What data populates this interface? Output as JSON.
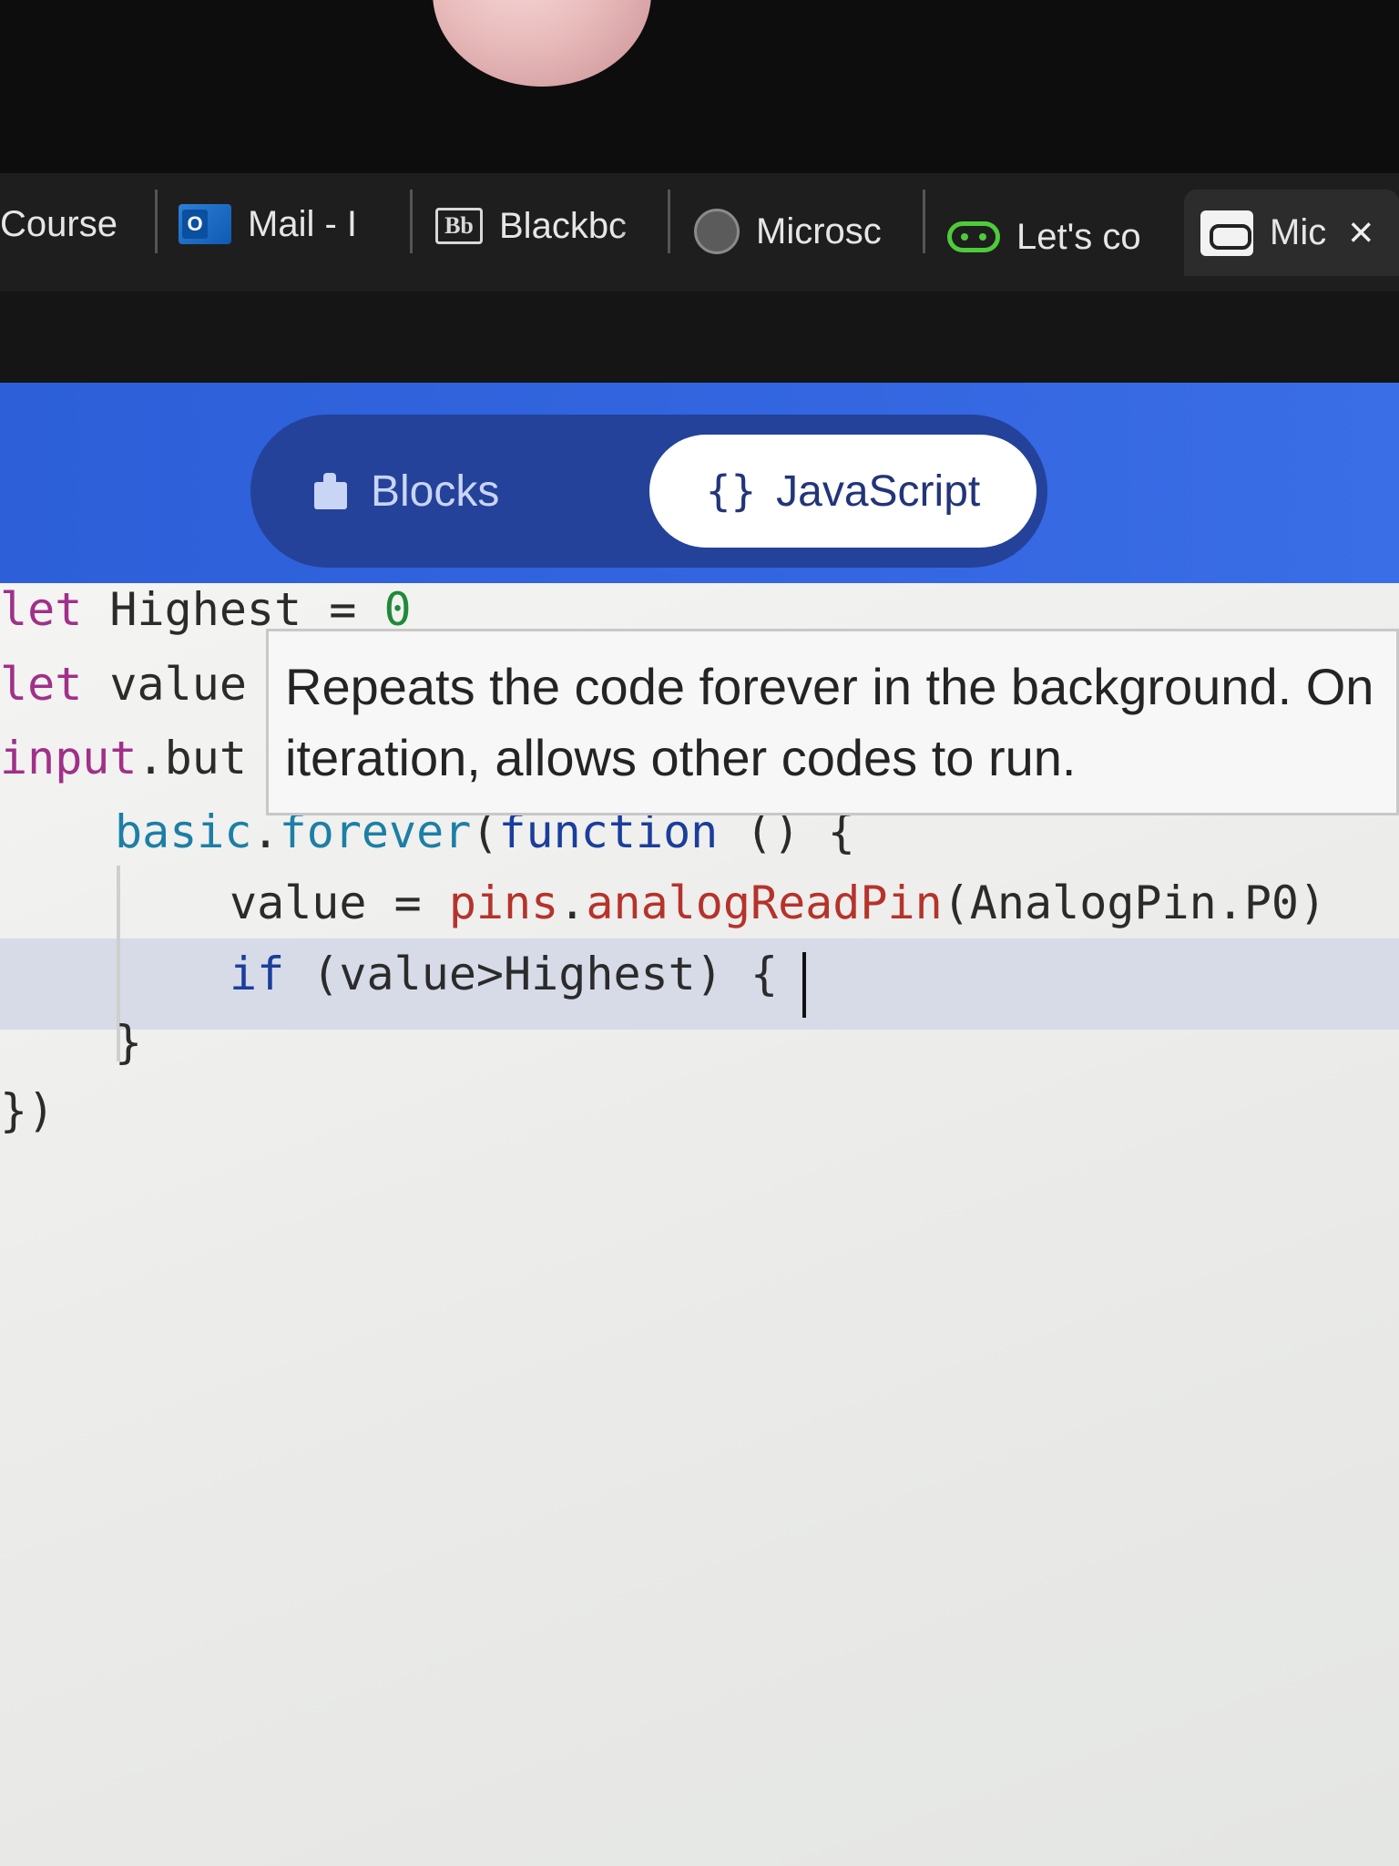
{
  "tabs": [
    {
      "title": "Course",
      "icon": "none"
    },
    {
      "title": "Mail - I",
      "icon": "outlook-icon"
    },
    {
      "title": "Blackbc",
      "icon": "blackboard-icon"
    },
    {
      "title": "Microsc",
      "icon": "globe-icon"
    },
    {
      "title": "Let's co",
      "icon": "microbit-icon"
    },
    {
      "title": "Mic",
      "icon": "microbit-icon",
      "active": true
    }
  ],
  "tab_close_glyph": "×",
  "editor_toggle": {
    "blocks_label": "Blocks",
    "javascript_label": "JavaScript",
    "selected": "JavaScript"
  },
  "code": {
    "line1": {
      "kw": "let",
      "rest": " Highest = ",
      "value": "0"
    },
    "line2": {
      "kw": "let",
      "rest": " value"
    },
    "line3": {
      "obj": "input",
      "rest": ".but"
    },
    "line4": {
      "obj": "basic",
      "dot": ".",
      "fn": "forever",
      "open": "(",
      "kw": "function",
      "rest": " () {"
    },
    "line5": {
      "pre": "value = ",
      "obj": "pins",
      "dot": ".",
      "fn": "analogReadPin",
      "rest": "(AnalogPin.P0)"
    },
    "line6": {
      "kw": "if",
      "rest": " (value>Highest) {"
    },
    "line7": "}",
    "line8": "})"
  },
  "tooltip": {
    "line1": "Repeats the code forever in the background. On",
    "line2": "iteration, allows other codes to run."
  },
  "colors": {
    "header_blue": "#3366e0",
    "toggle_dark": "#24429a",
    "keyword": "#1a3e9c",
    "function_name": "#b5332b"
  }
}
